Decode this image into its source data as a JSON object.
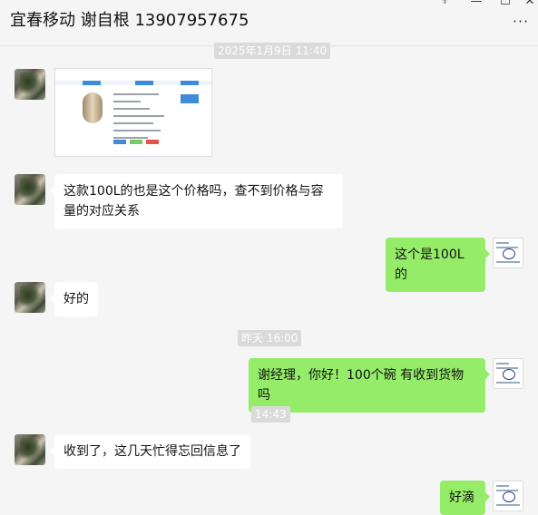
{
  "header": {
    "title": "宜春移动 谢自根 13907957675",
    "pin_icon": "pin-icon",
    "minimize_icon": "minimize-icon",
    "maximize_icon": "maximize-icon",
    "close_icon": "close-icon",
    "more_icon": "more-icon"
  },
  "timestamps": [
    "2025年1月9日 11:40",
    "昨天 16:00",
    "14:43"
  ],
  "messages": [
    {
      "side": "left",
      "type": "image",
      "alt": "product-screenshot"
    },
    {
      "side": "left",
      "type": "text",
      "text": "这款100L的也是这个价格吗，查不到价格与容量的对应关系"
    },
    {
      "side": "right",
      "type": "text",
      "text": "这个是100L的"
    },
    {
      "side": "left",
      "type": "text",
      "text": "好的"
    },
    {
      "side": "right",
      "type": "text",
      "text": "谢经理，你好！100个碗 有收到货物吗"
    },
    {
      "side": "left",
      "type": "text",
      "text": "收到了，这几天忙得忘回信息了"
    },
    {
      "side": "right",
      "type": "text",
      "text": "好滴"
    }
  ],
  "colors": {
    "background": "#f5f5f5",
    "incoming_bubble": "#ffffff",
    "outgoing_bubble": "#95ec69",
    "timestamp_bg": "#dadada"
  }
}
